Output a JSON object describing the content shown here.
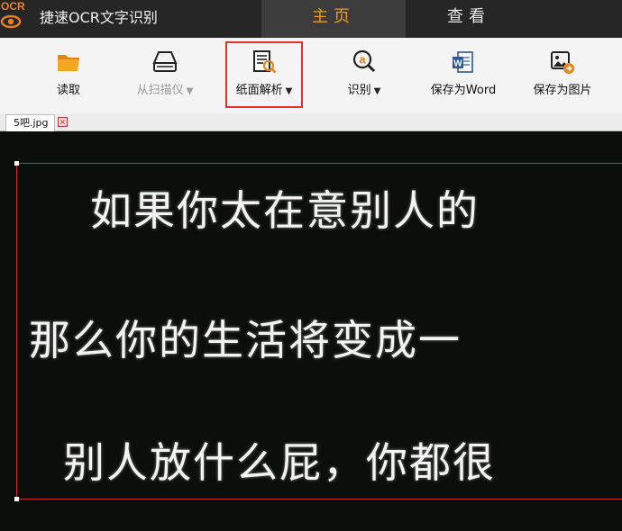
{
  "app": {
    "logo_text": "OCR",
    "title": "捷速OCR文字识别"
  },
  "tabs": [
    {
      "label": "主页",
      "active": true
    },
    {
      "label": "查看",
      "active": false
    }
  ],
  "toolbar": {
    "read_label": "读取",
    "scan_label": "从扫描仪",
    "parse_label": "纸面解析",
    "recognize_label": "识别",
    "save_word_label": "保存为Word",
    "save_image_label": "保存为图片",
    "dropdown_glyph": "▼"
  },
  "file_tab": {
    "name": "5吧.jpg",
    "close_glyph": "×"
  },
  "image_text": {
    "line1": "如果你太在意别人的",
    "line2": "那么你的生活将变成一",
    "line3": "别人放什么屁，你都很"
  },
  "colors": {
    "accent": "#f39a1e",
    "titlebar": "#262626",
    "highlight": "#e0302b"
  }
}
